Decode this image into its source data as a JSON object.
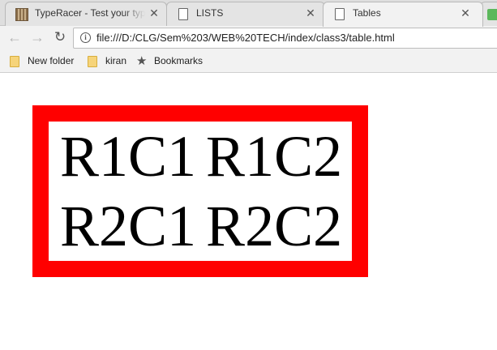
{
  "browser": {
    "tabs": [
      {
        "title": "TypeRacer - Test your typ",
        "icon": "typeracer-icon",
        "active": false
      },
      {
        "title": "LISTS",
        "icon": "document-icon",
        "active": false
      },
      {
        "title": "Tables",
        "icon": "document-icon",
        "active": true
      },
      {
        "title": "",
        "icon": "green-app-icon",
        "active": false
      }
    ],
    "close_glyph": "✕",
    "nav": {
      "back": "←",
      "forward": "→",
      "reload": "↻"
    },
    "info_glyph": "i",
    "url": "file:///D:/CLG/Sem%203/WEB%20TECH/index/class3/table.html",
    "bookmarks": [
      {
        "label": "New folder",
        "icon": "folder-icon"
      },
      {
        "label": "kiran",
        "icon": "folder-icon"
      },
      {
        "label": "Bookmarks",
        "icon": "star-icon"
      }
    ],
    "star_glyph": "★"
  },
  "table": {
    "border_color": "#ff0000",
    "rows": [
      [
        "R1C1",
        "R1C2"
      ],
      [
        "R2C1",
        "R2C2"
      ]
    ]
  }
}
